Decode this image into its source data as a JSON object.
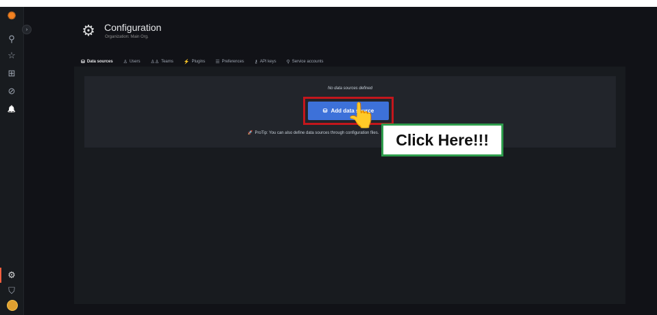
{
  "sidebar": {
    "logo_icon": "grafana-logo-icon",
    "expand_icon": "chevron-right-icon",
    "items": [
      {
        "name": "search",
        "icon": "search-icon",
        "glyph": "⚲"
      },
      {
        "name": "starred",
        "icon": "star-icon",
        "glyph": "☆"
      },
      {
        "name": "dashboards",
        "icon": "dashboards-grid-icon",
        "glyph": "⊞"
      },
      {
        "name": "explore",
        "icon": "compass-icon",
        "glyph": "⊘"
      },
      {
        "name": "alerting",
        "icon": "bell-icon",
        "glyph": "🔔"
      }
    ],
    "bottom_items": [
      {
        "name": "configuration",
        "icon": "gear-icon",
        "glyph": "⚙",
        "active": true
      },
      {
        "name": "server-admin",
        "icon": "shield-icon",
        "glyph": "⛉"
      },
      {
        "name": "profile",
        "icon": "avatar"
      }
    ],
    "accent_color": "#f55f3e"
  },
  "header": {
    "icon": "gear-icon",
    "title": "Configuration",
    "subtitle": "Organization: Main Org."
  },
  "tabs": [
    {
      "label": "Data sources",
      "icon": "database-icon",
      "glyph": "⛁",
      "active": true
    },
    {
      "label": "Users",
      "icon": "user-icon",
      "glyph": "♙"
    },
    {
      "label": "Teams",
      "icon": "users-icon",
      "glyph": "♙♙"
    },
    {
      "label": "Plugins",
      "icon": "plug-icon",
      "glyph": "⚡"
    },
    {
      "label": "Preferences",
      "icon": "sliders-icon",
      "glyph": "☰"
    },
    {
      "label": "API keys",
      "icon": "key-icon",
      "glyph": "⚷"
    },
    {
      "label": "Service accounts",
      "icon": "service-account-icon",
      "glyph": "⚲"
    }
  ],
  "main": {
    "empty_message": "No data sources defined",
    "add_button": {
      "label": "Add data source",
      "icon": "database-icon",
      "color": "#3d71d9"
    },
    "protip": {
      "icon": "rocket-icon",
      "text": "ProTip: You can also define data sources through configuration files."
    }
  },
  "annotation": {
    "callout_text": "Click Here!!!",
    "highlight_color": "#c4161c",
    "callout_border_color": "#2e9d4c",
    "cursor_icon": "hand-pointer-icon"
  }
}
